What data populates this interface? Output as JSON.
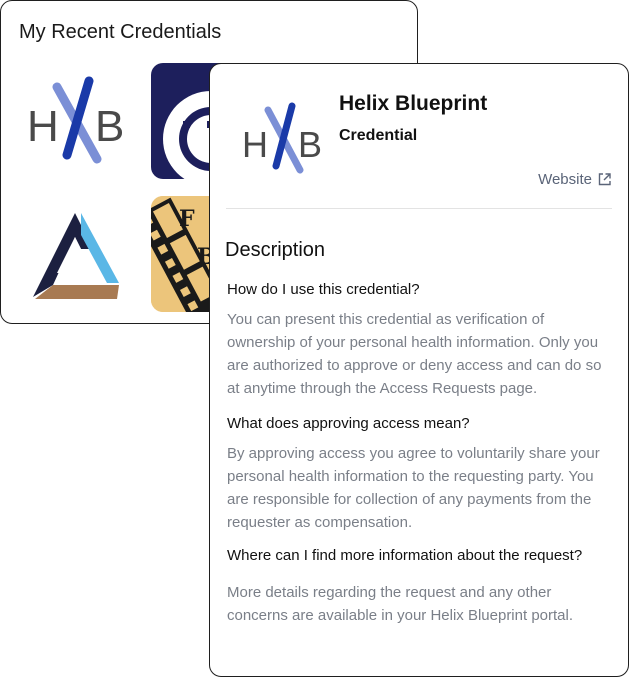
{
  "recent": {
    "title": "My Recent Credentials",
    "tiles": [
      {
        "name": "hxb-logo",
        "letters": "H B"
      },
      {
        "name": "blue-ring-logo"
      },
      {
        "name": "navy-logo"
      },
      {
        "name": "triangle-logo"
      },
      {
        "name": "film-logo",
        "letters": [
          "F",
          "B"
        ]
      }
    ]
  },
  "credential": {
    "title": "Helix Blueprint",
    "subtitle": "Credential",
    "website_label": "Website",
    "description_heading": "Description",
    "faqs": [
      {
        "question": "How do I use this credential?",
        "answer": "You can present this credential as verification of ownership of your personal health information. Only you are authorized to approve or deny access and can do so at anytime through the Access Requests page."
      },
      {
        "question": "What does approving access mean?",
        "answer": "By approving access you agree to voluntarily share your personal health information to the requesting party. You are responsible for collection of any payments from the requester as compensation."
      },
      {
        "question": "Where can I find more information about the request?",
        "answer": "More details regarding the request and any other concerns are available in your Helix Blueprint portal."
      }
    ]
  },
  "colors": {
    "hxb_gray": "#4a4a4a",
    "hxb_blue_dark": "#1a3aa8",
    "hxb_blue_light": "#7b8fd6",
    "link": "#5a6478",
    "answer_text": "#7a7f88"
  }
}
